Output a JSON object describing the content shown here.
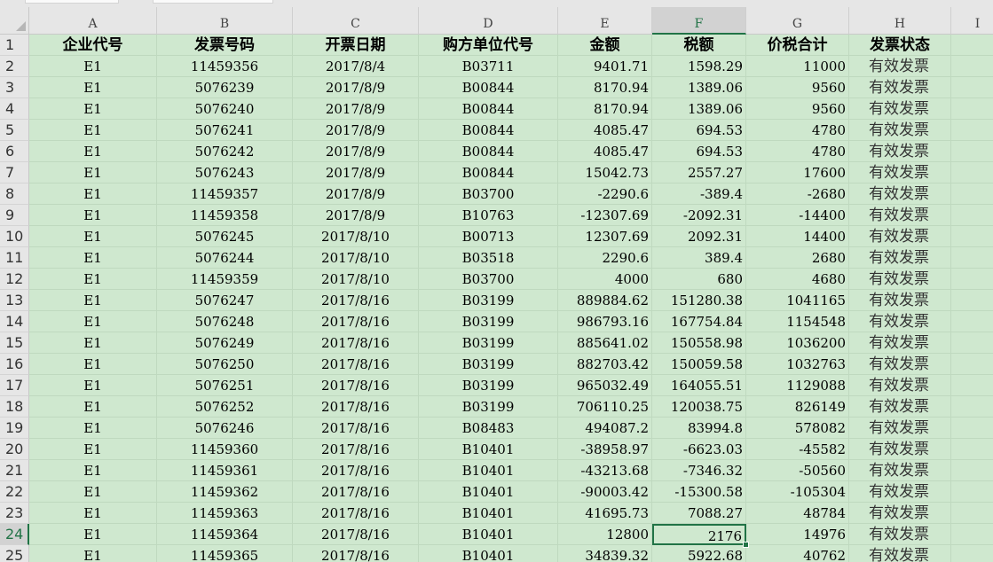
{
  "sheet": {
    "col_letters": [
      "A",
      "B",
      "C",
      "D",
      "E",
      "F",
      "G",
      "H",
      "I"
    ],
    "rows": [
      {
        "n": "1",
        "cells": [
          "企业代号",
          "发票号码",
          "开票日期",
          "购方单位代号",
          "金额",
          "税额",
          "价税合计",
          "发票状态"
        ]
      },
      {
        "n": "2",
        "cells": [
          "E1",
          "11459356",
          "2017/8/4",
          "B03711",
          "9401.71",
          "1598.29",
          "11000",
          "有效发票"
        ]
      },
      {
        "n": "3",
        "cells": [
          "E1",
          "5076239",
          "2017/8/9",
          "B00844",
          "8170.94",
          "1389.06",
          "9560",
          "有效发票"
        ]
      },
      {
        "n": "4",
        "cells": [
          "E1",
          "5076240",
          "2017/8/9",
          "B00844",
          "8170.94",
          "1389.06",
          "9560",
          "有效发票"
        ]
      },
      {
        "n": "5",
        "cells": [
          "E1",
          "5076241",
          "2017/8/9",
          "B00844",
          "4085.47",
          "694.53",
          "4780",
          "有效发票"
        ]
      },
      {
        "n": "6",
        "cells": [
          "E1",
          "5076242",
          "2017/8/9",
          "B00844",
          "4085.47",
          "694.53",
          "4780",
          "有效发票"
        ]
      },
      {
        "n": "7",
        "cells": [
          "E1",
          "5076243",
          "2017/8/9",
          "B00844",
          "15042.73",
          "2557.27",
          "17600",
          "有效发票"
        ]
      },
      {
        "n": "8",
        "cells": [
          "E1",
          "11459357",
          "2017/8/9",
          "B03700",
          "-2290.6",
          "-389.4",
          "-2680",
          "有效发票"
        ]
      },
      {
        "n": "9",
        "cells": [
          "E1",
          "11459358",
          "2017/8/9",
          "B10763",
          "-12307.69",
          "-2092.31",
          "-14400",
          "有效发票"
        ]
      },
      {
        "n": "10",
        "cells": [
          "E1",
          "5076245",
          "2017/8/10",
          "B00713",
          "12307.69",
          "2092.31",
          "14400",
          "有效发票"
        ]
      },
      {
        "n": "11",
        "cells": [
          "E1",
          "5076244",
          "2017/8/10",
          "B03518",
          "2290.6",
          "389.4",
          "2680",
          "有效发票"
        ]
      },
      {
        "n": "12",
        "cells": [
          "E1",
          "11459359",
          "2017/8/10",
          "B03700",
          "4000",
          "680",
          "4680",
          "有效发票"
        ]
      },
      {
        "n": "13",
        "cells": [
          "E1",
          "5076247",
          "2017/8/16",
          "B03199",
          "889884.62",
          "151280.38",
          "1041165",
          "有效发票"
        ]
      },
      {
        "n": "14",
        "cells": [
          "E1",
          "5076248",
          "2017/8/16",
          "B03199",
          "986793.16",
          "167754.84",
          "1154548",
          "有效发票"
        ]
      },
      {
        "n": "15",
        "cells": [
          "E1",
          "5076249",
          "2017/8/16",
          "B03199",
          "885641.02",
          "150558.98",
          "1036200",
          "有效发票"
        ]
      },
      {
        "n": "16",
        "cells": [
          "E1",
          "5076250",
          "2017/8/16",
          "B03199",
          "882703.42",
          "150059.58",
          "1032763",
          "有效发票"
        ]
      },
      {
        "n": "17",
        "cells": [
          "E1",
          "5076251",
          "2017/8/16",
          "B03199",
          "965032.49",
          "164055.51",
          "1129088",
          "有效发票"
        ]
      },
      {
        "n": "18",
        "cells": [
          "E1",
          "5076252",
          "2017/8/16",
          "B03199",
          "706110.25",
          "120038.75",
          "826149",
          "有效发票"
        ]
      },
      {
        "n": "19",
        "cells": [
          "E1",
          "5076246",
          "2017/8/16",
          "B08483",
          "494087.2",
          "83994.8",
          "578082",
          "有效发票"
        ]
      },
      {
        "n": "20",
        "cells": [
          "E1",
          "11459360",
          "2017/8/16",
          "B10401",
          "-38958.97",
          "-6623.03",
          "-45582",
          "有效发票"
        ]
      },
      {
        "n": "21",
        "cells": [
          "E1",
          "11459361",
          "2017/8/16",
          "B10401",
          "-43213.68",
          "-7346.32",
          "-50560",
          "有效发票"
        ]
      },
      {
        "n": "22",
        "cells": [
          "E1",
          "11459362",
          "2017/8/16",
          "B10401",
          "-90003.42",
          "-15300.58",
          "-105304",
          "有效发票"
        ]
      },
      {
        "n": "23",
        "cells": [
          "E1",
          "11459363",
          "2017/8/16",
          "B10401",
          "41695.73",
          "7088.27",
          "48784",
          "有效发票"
        ]
      },
      {
        "n": "24",
        "cells": [
          "E1",
          "11459364",
          "2017/8/16",
          "B10401",
          "12800",
          "2176",
          "14976",
          "有效发票"
        ]
      },
      {
        "n": "25",
        "cells": [
          "E1",
          "11459365",
          "2017/8/16",
          "B10401",
          "34839.32",
          "5922.68",
          "40762",
          "有效发票"
        ]
      }
    ],
    "selected_column": "F",
    "selected_row": "24",
    "colors": {
      "cell_fill": "#cfe8cf",
      "header_fill": "#e6e6e6",
      "selection": "#217346"
    }
  }
}
